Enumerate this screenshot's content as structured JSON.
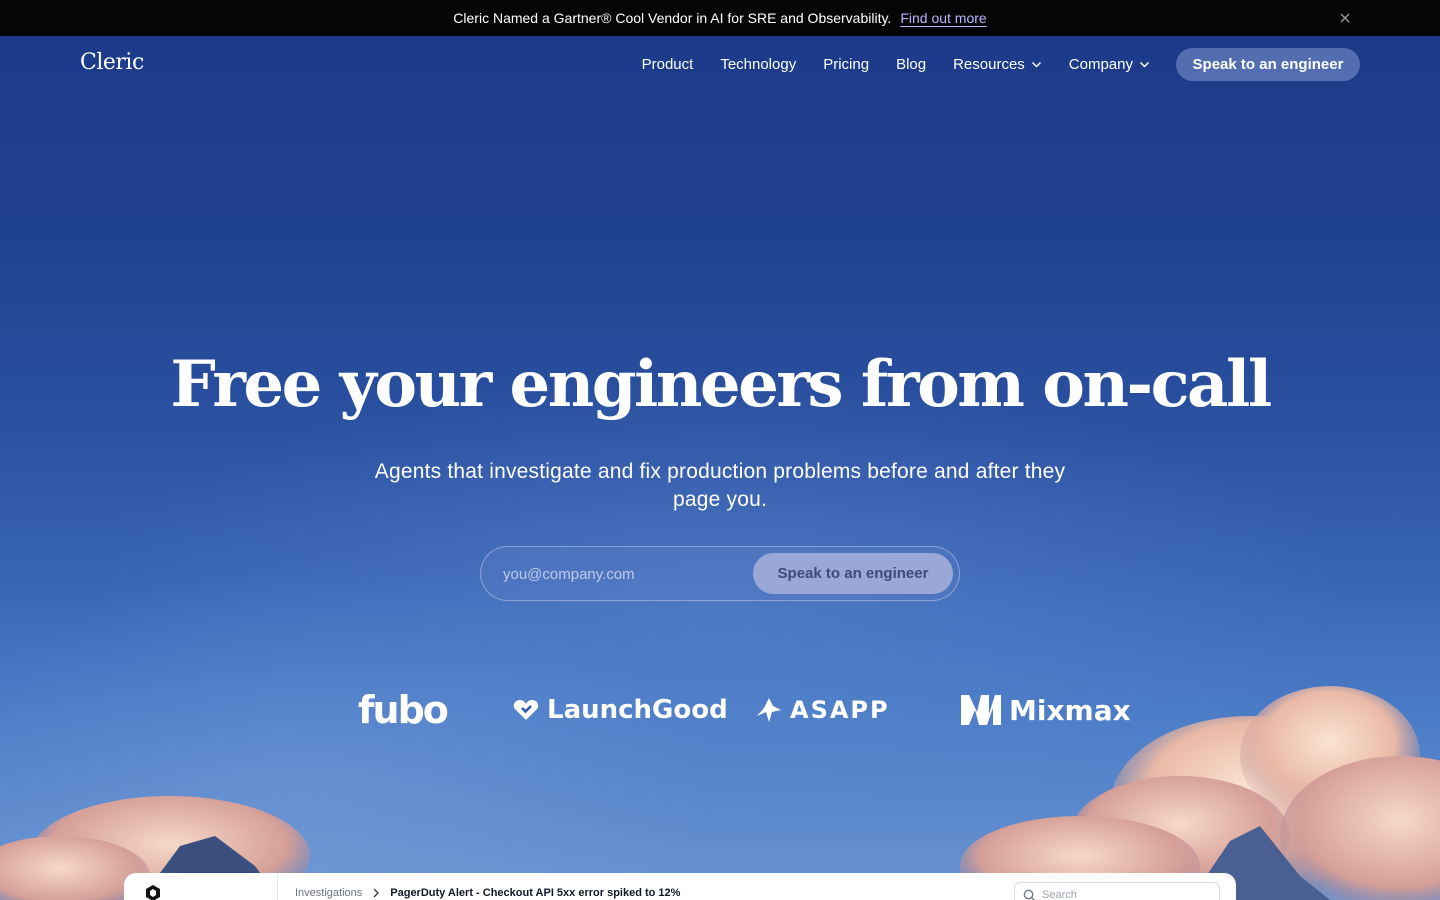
{
  "announcement": {
    "text": "Cleric Named a Gartner® Cool Vendor in AI for SRE and Observability.",
    "link": "Find out more"
  },
  "nav": {
    "logo": "Cleric",
    "links": [
      "Product",
      "Technology",
      "Pricing",
      "Blog",
      "Resources",
      "Company"
    ],
    "cta": "Speak to an engineer"
  },
  "hero": {
    "headline": "Free your engineers from on-call",
    "subhead": "Agents that investigate and fix production problems before and after they page you.",
    "email_placeholder": "you@company.com",
    "cta": "Speak to an engineer"
  },
  "customers": [
    "fubo",
    "LaunchGood",
    "ASAPP",
    "Mixmax"
  ],
  "preview": {
    "breadcrumb_root": "Investigations",
    "breadcrumb_current": "PagerDuty Alert - Checkout API 5xx error spiked to 12%",
    "search_placeholder": "Search"
  },
  "colors": {
    "accent_link": "#b9b4ff",
    "background": "#1e3c8a"
  }
}
